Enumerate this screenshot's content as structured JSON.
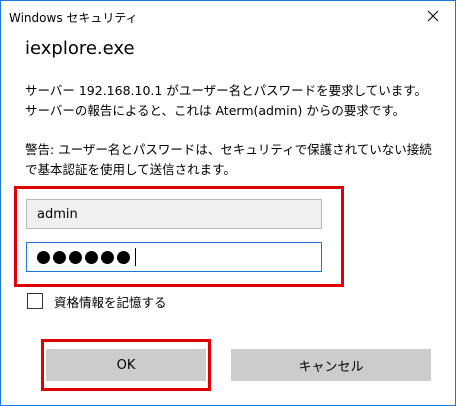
{
  "window": {
    "title": "Windows セキュリティ",
    "close_icon": "close-icon"
  },
  "app_name": "iexplore.exe",
  "message1": "サーバー 192.168.10.1 がユーザー名とパスワードを要求しています。サーバーの報告によると、これは Aterm(admin) からの要求です。",
  "message2": "警告: ユーザー名とパスワードは、セキュリティで保護されていない接続で基本認証を使用して送信されます。",
  "username": {
    "value": "admin"
  },
  "password": {
    "masked_length": 6
  },
  "remember": {
    "label": "資格情報を記憶する",
    "checked": false
  },
  "buttons": {
    "ok": "OK",
    "cancel": "キャンセル"
  },
  "colors": {
    "accent": "#1b78d7",
    "highlight": "#e00000",
    "button_bg": "#cccccc"
  }
}
